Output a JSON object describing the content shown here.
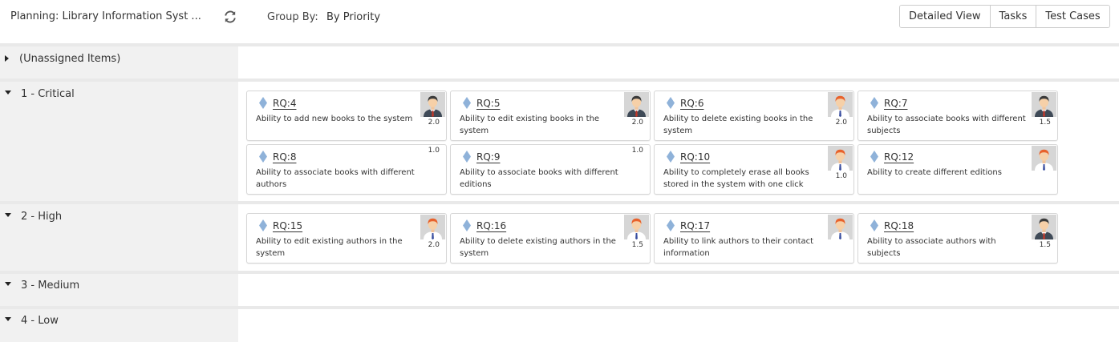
{
  "header": {
    "planning_title": "Planning: Library Information Syst ...",
    "groupby_label": "Group By:",
    "groupby_value": "By Priority",
    "buttons": [
      "Detailed View",
      "Tasks",
      "Test Cases"
    ]
  },
  "colors": {
    "diamond": "#8fb2d9",
    "separator": "#e9e9e9",
    "left_panel": "#f1f1f1"
  },
  "groups": [
    {
      "label": "(Unassigned Items)",
      "expanded": false
    },
    {
      "label": "1 - Critical",
      "expanded": true
    },
    {
      "label": "2 - High",
      "expanded": true
    },
    {
      "label": "3 - Medium",
      "expanded": true
    },
    {
      "label": "4 - Low",
      "expanded": true
    }
  ],
  "cards": [
    {
      "id": "RQ:4",
      "desc": "Ability to add new books to the system",
      "estimate": "2.0",
      "avatar": "dark-hair-male"
    },
    {
      "id": "RQ:5",
      "desc": "Ability to edit existing books in the system",
      "estimate": "2.0",
      "avatar": "dark-hair-male"
    },
    {
      "id": "RQ:6",
      "desc": "Ability to delete existing books in the system",
      "estimate": "2.0",
      "avatar": "red-hair-male"
    },
    {
      "id": "RQ:7",
      "desc": "Ability to associate books with different subjects",
      "estimate": "1.5",
      "avatar": "dark-hair-male"
    },
    {
      "id": "RQ:8",
      "desc": "Ability to associate books with different authors",
      "estimate": "1.0",
      "avatar": ""
    },
    {
      "id": "RQ:9",
      "desc": "Ability to associate books with different editions",
      "estimate": "1.0",
      "avatar": ""
    },
    {
      "id": "RQ:10",
      "desc": "Ability to completely erase all books stored in the system with one click",
      "estimate": "1.0",
      "avatar": "red-hair-male"
    },
    {
      "id": "RQ:12",
      "desc": "Ability to create different editions",
      "estimate": "",
      "avatar": "red-hair-male"
    },
    {
      "id": "RQ:15",
      "desc": "Ability to edit existing authors in the system",
      "estimate": "2.0",
      "avatar": "red-hair-male"
    },
    {
      "id": "RQ:16",
      "desc": "Ability to delete existing authors in the system",
      "estimate": "1.5",
      "avatar": "red-hair-male"
    },
    {
      "id": "RQ:17",
      "desc": "Ability to link authors to their contact information",
      "estimate": "",
      "avatar": "red-hair-male"
    },
    {
      "id": "RQ:18",
      "desc": "Ability to associate authors with subjects",
      "estimate": "1.5",
      "avatar": "dark-hair-male"
    }
  ]
}
